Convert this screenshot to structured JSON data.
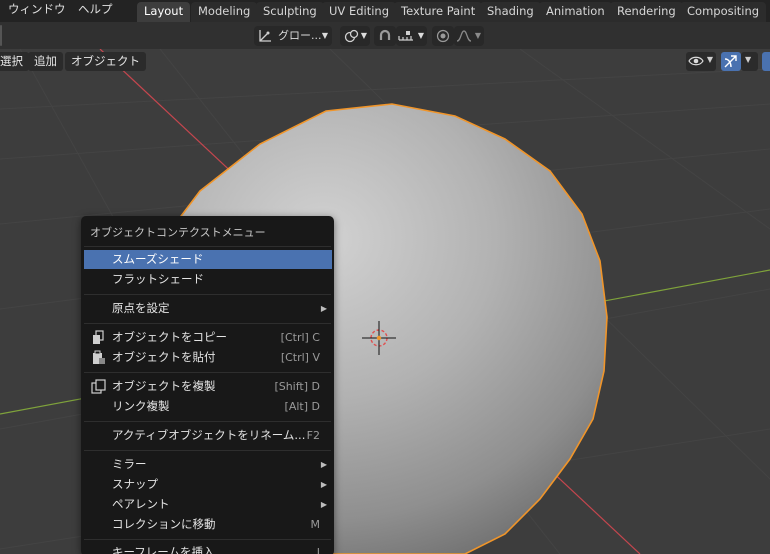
{
  "topbar": {
    "menus": [
      "ウィンドウ",
      "ヘルプ"
    ],
    "workspace_tabs": [
      "Layout",
      "Modeling",
      "Sculpting",
      "UV Editing",
      "Texture Paint",
      "Shading",
      "Animation",
      "Rendering",
      "Compositing"
    ],
    "active_tab": "Layout"
  },
  "header": {
    "transform_orientation": "グロー...",
    "icons": [
      "transform-orientation-icon",
      "pivot-point-icon",
      "snap-magnet-icon",
      "snap-increment-icon",
      "proportional-edit-icon",
      "falloff-curve-icon"
    ]
  },
  "viewport": {
    "menus": [
      "選択",
      "追加",
      "オブジェクト"
    ],
    "right_icons": [
      "visibility-eye-icon",
      "gizmo-icon"
    ]
  },
  "context_menu": {
    "title": "オブジェクトコンテクストメニュー",
    "items": [
      {
        "label": "スムーズシェード",
        "shortcut": "",
        "highlighted": true
      },
      {
        "label": "フラットシェード",
        "shortcut": ""
      },
      {
        "label": "原点を設定",
        "shortcut": "",
        "submenu": true
      },
      {
        "label": "オブジェクトをコピー",
        "shortcut": "[Ctrl] C",
        "icon": "copy-icon"
      },
      {
        "label": "オブジェクトを貼付",
        "shortcut": "[Ctrl] V",
        "icon": "paste-icon"
      },
      {
        "label": "オブジェクトを複製",
        "shortcut": "[Shift] D",
        "icon": "duplicate-icon"
      },
      {
        "label": "リンク複製",
        "shortcut": "[Alt] D"
      },
      {
        "label": "アクティブオブジェクトをリネーム...",
        "shortcut": "F2"
      },
      {
        "label": "ミラー",
        "shortcut": "",
        "submenu": true
      },
      {
        "label": "スナップ",
        "shortcut": "",
        "submenu": true
      },
      {
        "label": "ペアレント",
        "shortcut": "",
        "submenu": true
      },
      {
        "label": "コレクションに移動",
        "shortcut": "M"
      },
      {
        "label": "キーフレームを挿入",
        "shortcut": "I"
      }
    ]
  },
  "colors": {
    "selection_outline": "#f0952a",
    "menu_highlight": "#4a72b0",
    "x_axis": "#c4464e",
    "y_axis": "#7fa33b"
  }
}
